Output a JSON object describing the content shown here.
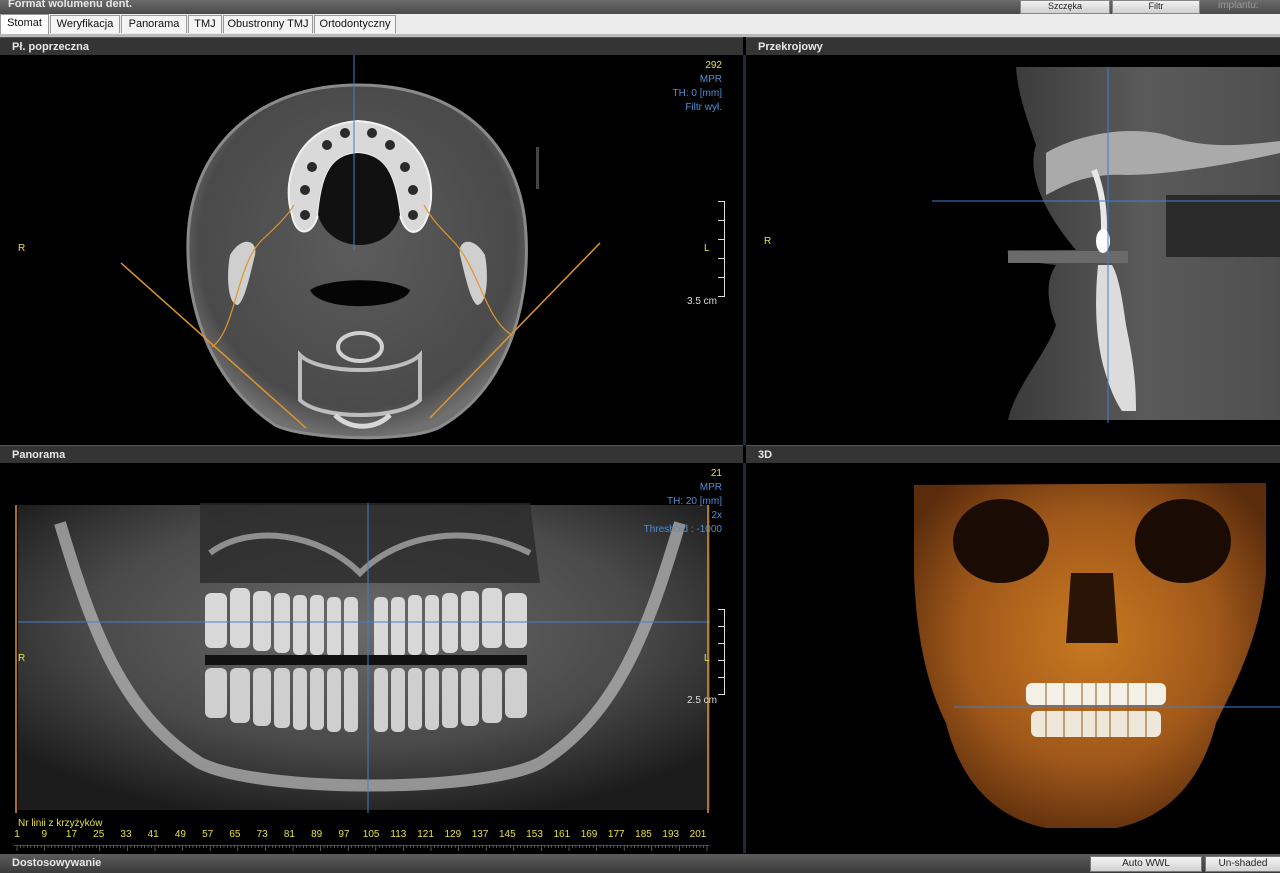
{
  "window": {
    "title": "Format wolumenu dent."
  },
  "toolbar": {
    "jaw_label": "Szczęka",
    "filter_label": "Filtr",
    "implant_label": "implantu:"
  },
  "tabs": [
    {
      "label": "Stomat",
      "active": true
    },
    {
      "label": "Weryfikacja",
      "active": false
    },
    {
      "label": "Panorama",
      "active": false
    },
    {
      "label": "TMJ",
      "active": false
    },
    {
      "label": "Obustronny TMJ",
      "active": false
    },
    {
      "label": "Ortodontyczny",
      "active": false
    }
  ],
  "panels": {
    "axial": {
      "title": "Pł. poprzeczna",
      "slice": "292",
      "mode": "MPR",
      "thickness": "TH: 0 [mm]",
      "filter": "Filtr wył.",
      "side_right": "R",
      "side_left": "L",
      "scale": "3.5 cm"
    },
    "cross": {
      "title": "Przekrojowy",
      "side_right": "R"
    },
    "panorama": {
      "title": "Panorama",
      "slice": "21",
      "mode": "MPR",
      "thickness": "TH: 20 [mm]",
      "zoom": "2x",
      "threshold": "Threshold : -1000",
      "side_right": "R",
      "side_left": "L",
      "scale": "2.5 cm",
      "ruler_label": "Nr linii z krzyżyków",
      "ruler_numbers": [
        "1",
        "9",
        "17",
        "25",
        "33",
        "41",
        "49",
        "57",
        "65",
        "73",
        "81",
        "89",
        "97",
        "105",
        "113",
        "121",
        "129",
        "137",
        "145",
        "153",
        "161",
        "169",
        "177",
        "185",
        "193",
        "201"
      ]
    },
    "render3d": {
      "title": "3D"
    }
  },
  "bottom": {
    "label": "Dostosowywanie",
    "auto_wwl": "Auto WWL",
    "unshaded": "Un-shaded"
  },
  "colors": {
    "overlay_yellow": "#e6e040",
    "overlay_blue": "#4b8fd6",
    "guide_orange": "#e0962a",
    "crosshair": "#3f7fd0"
  }
}
